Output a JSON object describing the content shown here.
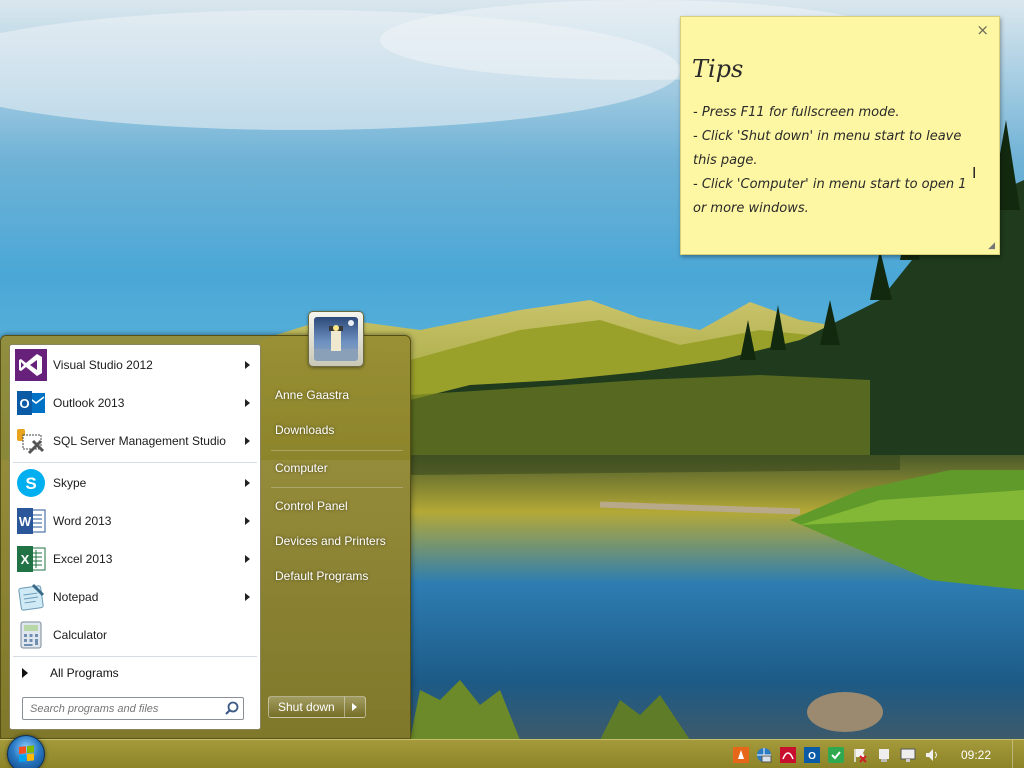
{
  "desktop": {
    "wallpaper": "mountain-lake-landscape"
  },
  "sticky_note": {
    "title": "Tips",
    "lines": [
      "- Press F11 for fullscreen mode.",
      "- Click 'Shut down' in menu start to leave",
      "this page.",
      "- Click 'Computer' in menu start to open 1",
      "or more windows."
    ],
    "close_glyph": "×"
  },
  "start_menu": {
    "programs": [
      {
        "label": "Visual Studio 2012",
        "icon": "visual-studio-icon",
        "has_submenu": true
      },
      {
        "label": "Outlook 2013",
        "icon": "outlook-icon",
        "has_submenu": true
      },
      {
        "label": "SQL Server Management Studio",
        "icon": "sql-server-icon",
        "has_submenu": true
      },
      {
        "label": "Skype",
        "icon": "skype-icon",
        "has_submenu": true
      },
      {
        "label": "Word 2013",
        "icon": "word-icon",
        "has_submenu": true
      },
      {
        "label": "Excel 2013",
        "icon": "excel-icon",
        "has_submenu": true
      },
      {
        "label": "Notepad",
        "icon": "notepad-icon",
        "has_submenu": true
      },
      {
        "label": "Calculator",
        "icon": "calculator-icon",
        "has_submenu": false
      }
    ],
    "all_programs_label": "All Programs",
    "search_placeholder": "Search programs and files",
    "right_items": [
      "Anne Gaastra",
      "Downloads",
      "Computer",
      "Control Panel",
      "Devices and Printers",
      "Default Programs"
    ],
    "shutdown_label": "Shut down"
  },
  "taskbar": {
    "clock": "09:22",
    "tray_icons": [
      "vlc-icon",
      "network-globe-icon",
      "pdf-icon",
      "outlook-tray-icon",
      "security-check-icon",
      "action-center-flag-icon",
      "usb-device-icon",
      "display-icon",
      "volume-icon"
    ]
  },
  "colors": {
    "start_menu_tint": "#978c32",
    "taskbar": "#9a9034",
    "sticky_note": "#fdf6a3"
  }
}
